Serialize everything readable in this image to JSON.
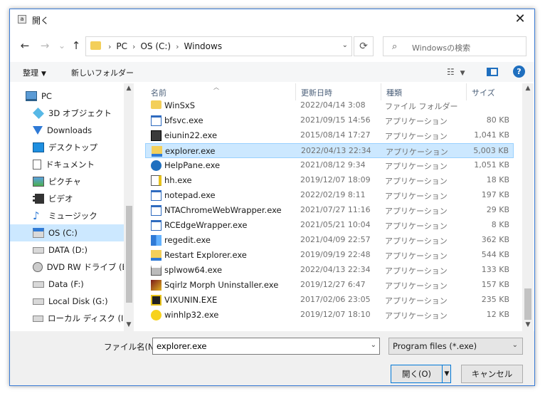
{
  "window": {
    "title": "開く",
    "close": "✕"
  },
  "nav": {
    "back": "←",
    "forward": "→",
    "recent": "⌄",
    "up": "↑"
  },
  "address": {
    "crumbs": [
      "PC",
      "OS (C:)",
      "Windows"
    ],
    "separator": "›"
  },
  "search": {
    "placeholder": "Windowsの検索"
  },
  "toolbar": {
    "organize": "整理",
    "new_folder": "新しいフォルダー"
  },
  "sidebar": {
    "items": [
      {
        "label": "PC",
        "icon": "computer-icon"
      },
      {
        "label": "3D オブジェクト",
        "icon": "cube-icon"
      },
      {
        "label": "Downloads",
        "icon": "download-arrow-icon"
      },
      {
        "label": "デスクトップ",
        "icon": "desktop-icon"
      },
      {
        "label": "ドキュメント",
        "icon": "document-icon"
      },
      {
        "label": "ピクチャ",
        "icon": "picture-icon"
      },
      {
        "label": "ビデオ",
        "icon": "film-icon"
      },
      {
        "label": "ミュージック",
        "icon": "music-note-icon"
      },
      {
        "label": "OS (C:)",
        "icon": "windows-drive-icon",
        "selected": true
      },
      {
        "label": "DATA (D:)",
        "icon": "drive-icon"
      },
      {
        "label": "DVD RW ドライブ (E:) .",
        "icon": "dvd-icon"
      },
      {
        "label": "Data (F:)",
        "icon": "drive-icon"
      },
      {
        "label": "Local Disk (G:)",
        "icon": "drive-icon"
      },
      {
        "label": "ローカル ディスク (I:)",
        "icon": "drive-icon"
      }
    ]
  },
  "columns": {
    "name": "名前",
    "date": "更新日時",
    "type": "種類",
    "size": "サイズ"
  },
  "files": [
    {
      "name": "WinSxS",
      "date": "2022/04/14 3:08",
      "type": "ファイル フォルダー",
      "size": "",
      "icon": "folder-icon"
    },
    {
      "name": "bfsvc.exe",
      "date": "2021/09/15 14:56",
      "type": "アプリケーション",
      "size": "80 KB",
      "icon": "app-window-icon"
    },
    {
      "name": "eiunin22.exe",
      "date": "2015/08/14 17:27",
      "type": "アプリケーション",
      "size": "1,041 KB",
      "icon": "installer-icon"
    },
    {
      "name": "explorer.exe",
      "date": "2022/04/13 22:34",
      "type": "アプリケーション",
      "size": "5,003 KB",
      "icon": "explorer-folder-icon",
      "selected": true
    },
    {
      "name": "HelpPane.exe",
      "date": "2021/08/12 9:34",
      "type": "アプリケーション",
      "size": "1,051 KB",
      "icon": "help-icon"
    },
    {
      "name": "hh.exe",
      "date": "2019/12/07 18:09",
      "type": "アプリケーション",
      "size": "18 KB",
      "icon": "help-book-icon"
    },
    {
      "name": "notepad.exe",
      "date": "2022/02/19 8:11",
      "type": "アプリケーション",
      "size": "197 KB",
      "icon": "app-window-icon"
    },
    {
      "name": "NTAChromeWebWrapper.exe",
      "date": "2021/07/27 11:16",
      "type": "アプリケーション",
      "size": "29 KB",
      "icon": "app-window-icon"
    },
    {
      "name": "RCEdgeWrapper.exe",
      "date": "2021/05/21 10:04",
      "type": "アプリケーション",
      "size": "8 KB",
      "icon": "app-window-icon"
    },
    {
      "name": "regedit.exe",
      "date": "2021/04/09 22:57",
      "type": "アプリケーション",
      "size": "362 KB",
      "icon": "registry-icon"
    },
    {
      "name": "Restart Explorer.exe",
      "date": "2019/09/19 22:48",
      "type": "アプリケーション",
      "size": "544 KB",
      "icon": "restart-icon"
    },
    {
      "name": "splwow64.exe",
      "date": "2022/04/13 22:34",
      "type": "アプリケーション",
      "size": "133 KB",
      "icon": "printer-icon"
    },
    {
      "name": "Sqirlz Morph Uninstaller.exe",
      "date": "2019/12/27 6:47",
      "type": "アプリケーション",
      "size": "157 KB",
      "icon": "uninstaller-icon"
    },
    {
      "name": "VIXUNIN.EXE",
      "date": "2017/02/06 23:05",
      "type": "アプリケーション",
      "size": "235 KB",
      "icon": "cross-icon"
    },
    {
      "name": "winhlp32.exe",
      "date": "2019/12/07 18:10",
      "type": "アプリケーション",
      "size": "12 KB",
      "icon": "question-icon"
    }
  ],
  "footer": {
    "filename_label": "ファイル名(N):",
    "filename_value": "explorer.exe",
    "filter": "Program files (*.exe)",
    "open": "開く(O)",
    "cancel": "キャンセル"
  },
  "colors": {
    "accent": "#0078d7",
    "selection": "#cce8ff",
    "header_text": "#4c607a"
  }
}
